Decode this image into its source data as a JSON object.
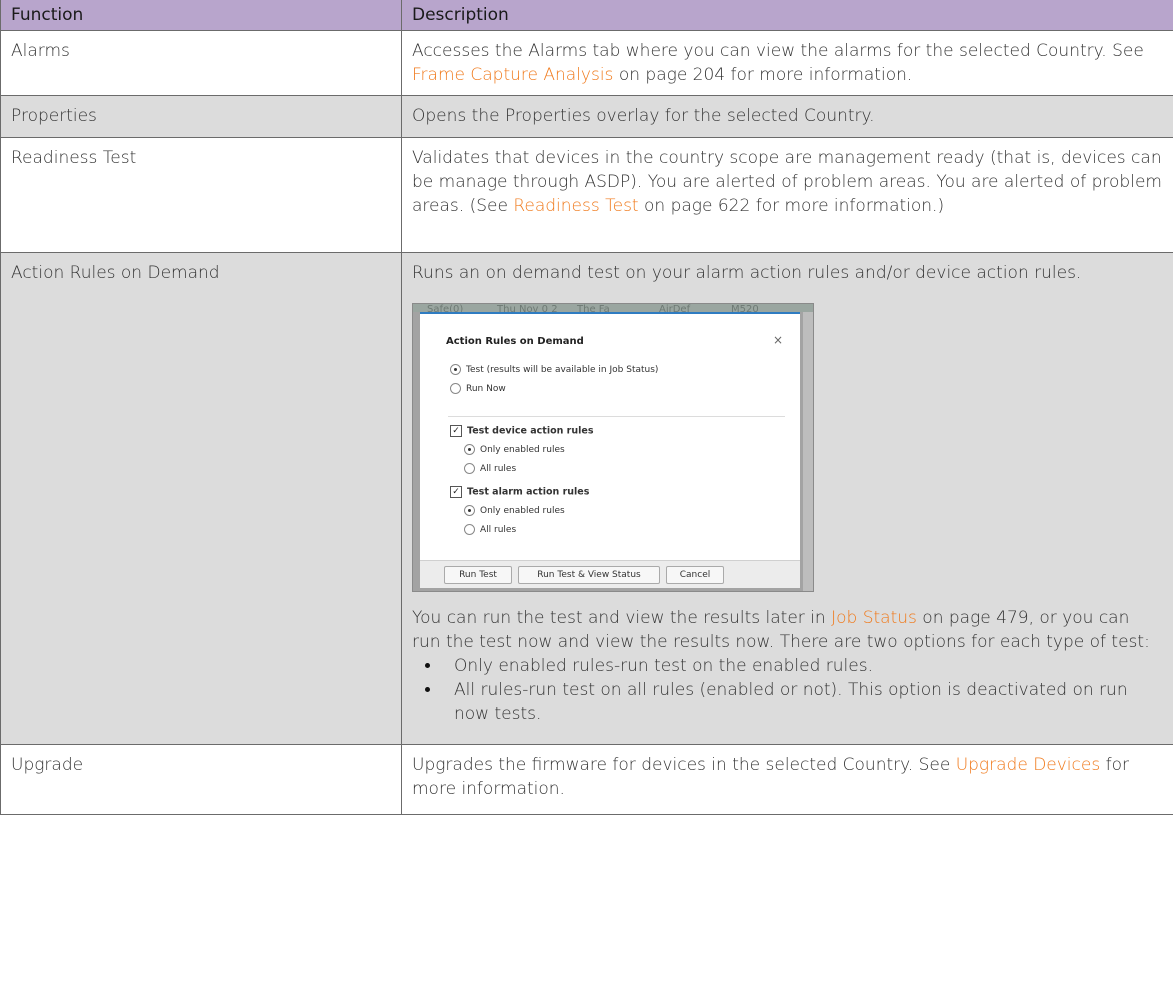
{
  "table": {
    "headers": [
      "Function",
      "Description"
    ],
    "rows": {
      "alarms": {
        "function": "Alarms",
        "desc_pre": "Accesses the Alarms tab where you can view the alarms for the selected Country. See ",
        "link": "Frame Capture Analysis",
        "desc_post": " on page 204 for more information."
      },
      "properties": {
        "function": "Properties",
        "desc": "Opens the Properties overlay for the selected Country."
      },
      "readiness": {
        "function": "Readiness Test",
        "desc_pre": "Validates that devices in the country scope are management ready (that is, devices can be manage through ASDP). You are alerted of problem areas. You are alerted of problem areas. (See ",
        "link": "Readiness Test",
        "desc_post": " on page 622 for more information.)"
      },
      "action_rules": {
        "function": "Action Rules on Demand",
        "desc_intro": "Runs an on demand test on your alarm action rules and/or device action rules.",
        "para_pre": "You can run the test and view the results later in ",
        "para_link": "Job Status",
        "para_post": " on page 479, or you can run the test now and view the results now. There are two options for each type of test:",
        "bullets": [
          "Only enabled rules-run test on the enabled rules.",
          "All rules-run test on all rules (enabled or not). This option is deactivated on run now tests."
        ]
      },
      "upgrade": {
        "function": "Upgrade",
        "desc_pre": "Upgrades the firmware for devices in the selected Country. See ",
        "link": "Upgrade Devices",
        "desc_post": " for more information."
      }
    }
  },
  "dialog": {
    "background_strip": [
      "Safe(0)",
      "Thu Nov 0 2",
      "The Fa",
      "AirDef",
      "M520"
    ],
    "title": "Action Rules on Demand",
    "close": "×",
    "mode_options": [
      "Test (results will be available in Job Status)",
      "Run Now"
    ],
    "device_check_label": "Test device action rules",
    "device_options": [
      "Only enabled rules",
      "All rules"
    ],
    "alarm_check_label": "Test alarm action rules",
    "alarm_options": [
      "Only enabled rules",
      "All rules"
    ],
    "buttons": {
      "run_test": "Run Test",
      "run_test_view": "Run Test & View Status",
      "cancel": "Cancel"
    }
  },
  "colors": {
    "header_bg": "#b8a5cc",
    "shaded_row_bg": "#dcdcdc",
    "link": "#f07a1c",
    "dialog_accent": "#2f7cc1"
  }
}
